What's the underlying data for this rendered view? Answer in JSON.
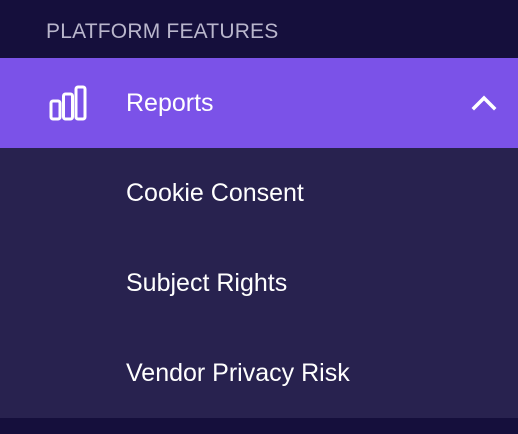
{
  "section": {
    "title": "PLATFORM FEATURES"
  },
  "nav": {
    "parent": {
      "label": "Reports",
      "icon": "bar-chart-icon",
      "expanded": true,
      "state_icon": "chevron-up-icon"
    },
    "children": [
      {
        "label": "Cookie Consent"
      },
      {
        "label": "Subject Rights"
      },
      {
        "label": "Vendor Privacy Risk"
      }
    ]
  },
  "colors": {
    "background": "#150f3c",
    "active_item": "#7b52e8",
    "submenu_background": "#28224f",
    "section_text": "#b9b6cc",
    "item_text": "#ffffff"
  }
}
